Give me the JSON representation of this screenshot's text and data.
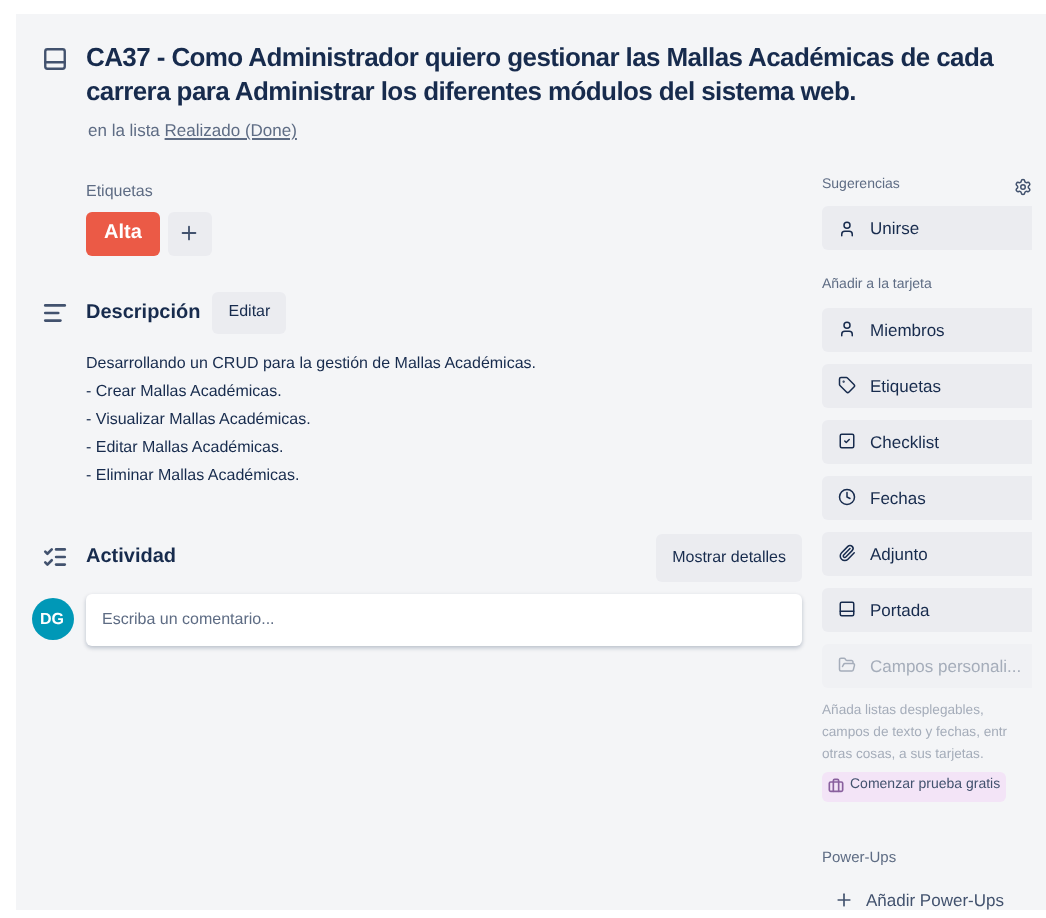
{
  "card": {
    "title": "CA37 - Como Administrador quiero gestionar las Mallas Académicas de cada carrera para Administrar los diferentes módulos del sistema web.",
    "list_prefix": "en la lista",
    "list_name": "Realizado (Done)"
  },
  "labels": {
    "heading": "Etiquetas",
    "items": [
      {
        "text": "Alta",
        "color": "#eb5a46"
      }
    ]
  },
  "description": {
    "heading": "Descripción",
    "edit": "Editar",
    "lines": [
      "Desarrollando un CRUD para la gestión de Mallas Académicas.",
      "- Crear Mallas Académicas.",
      "- Visualizar Mallas Académicas.",
      "- Editar Mallas Académicas.",
      "- Eliminar Mallas Académicas."
    ]
  },
  "activity": {
    "heading": "Actividad",
    "toggle": "Mostrar detalles",
    "avatar": "DG",
    "comment": {
      "placeholder": "Escriba un comentario..."
    }
  },
  "sidebar": {
    "suggestions": {
      "heading": "Sugerencias",
      "items": [
        {
          "label": "Unirse",
          "disabled": false
        }
      ]
    },
    "add_to_card": {
      "heading": "Añadir a la tarjeta",
      "items": [
        {
          "label": "Miembros",
          "disabled": false
        },
        {
          "label": "Etiquetas",
          "disabled": false
        },
        {
          "label": "Checklist",
          "disabled": false
        },
        {
          "label": "Fechas",
          "disabled": false
        },
        {
          "label": "Adjunto",
          "disabled": false
        },
        {
          "label": "Portada",
          "disabled": false
        },
        {
          "label": "Campos personali...",
          "disabled": true
        }
      ]
    },
    "hint_lines": [
      "Añada listas desplegables,",
      "campos de texto y fechas, entr",
      "otras cosas, a sus tarjetas."
    ],
    "trial": "Comenzar prueba gratis",
    "powerups": {
      "heading": "Power-Ups",
      "add": "Añadir Power-Ups"
    }
  }
}
